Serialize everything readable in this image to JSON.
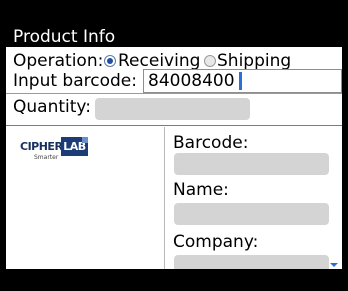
{
  "title": "Product Info",
  "operation": {
    "label": "Operation:",
    "options": [
      "Receiving",
      "Shipping"
    ],
    "selected": "Receiving"
  },
  "barcode_input": {
    "label": "Input barcode:",
    "value": "84008400"
  },
  "quantity": {
    "label": "Quantity:",
    "value": ""
  },
  "logo": {
    "cipher": "CIPHER",
    "lab": "LAB",
    "tagline": "Smarter"
  },
  "details": {
    "barcode_label": "Barcode:",
    "barcode_value": "",
    "name_label": "Name:",
    "name_value": "",
    "company_label": "Company:",
    "company_value": ""
  },
  "colors": {
    "accent": "#2a70d8",
    "field_bg": "#d4d4d4",
    "background": "#000000",
    "content_bg": "#ffffff"
  }
}
